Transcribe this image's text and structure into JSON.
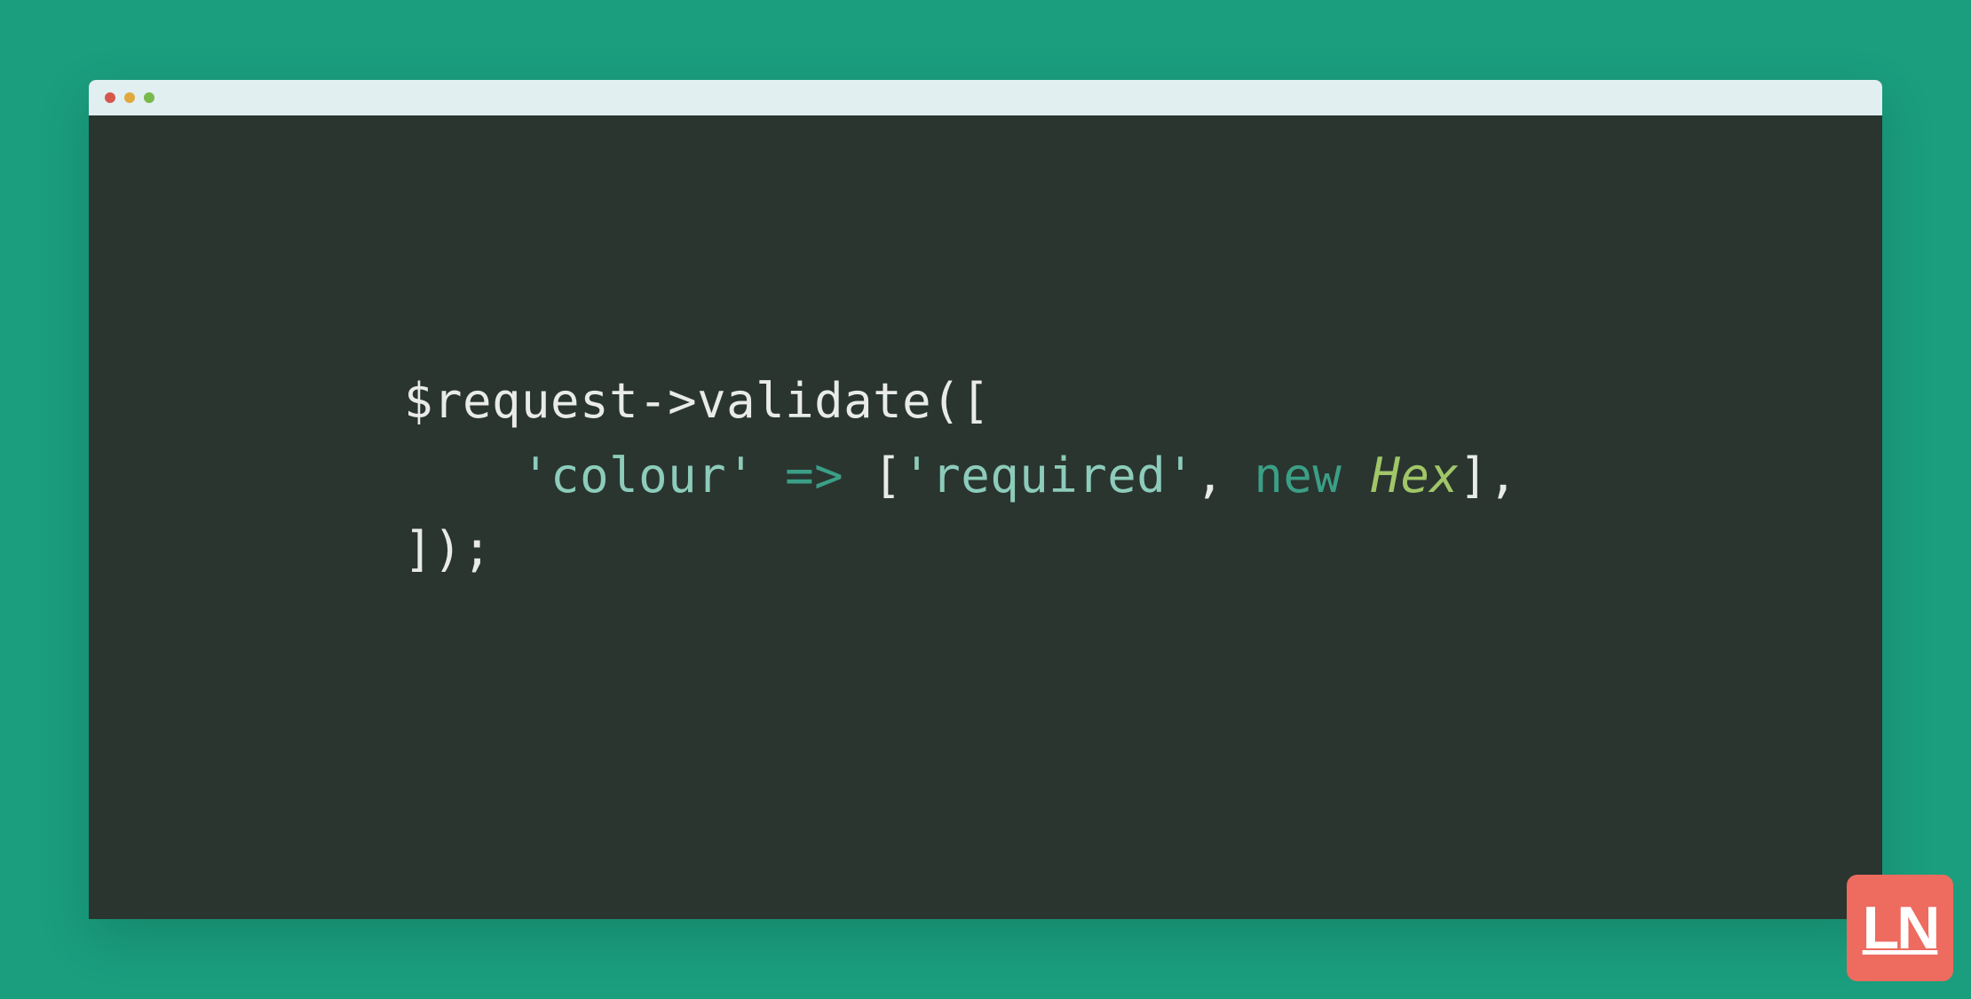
{
  "code": {
    "line1": {
      "part1": "$request->validate(["
    },
    "line2": {
      "indent": "    ",
      "string1": "'colour'",
      "arrow": " => ",
      "bracket1": "[",
      "string2": "'required'",
      "comma": ", ",
      "keyword": "new ",
      "classname": "Hex",
      "bracket2": "],"
    },
    "line3": {
      "part1": "]);"
    }
  },
  "logo": {
    "text": "LN"
  }
}
